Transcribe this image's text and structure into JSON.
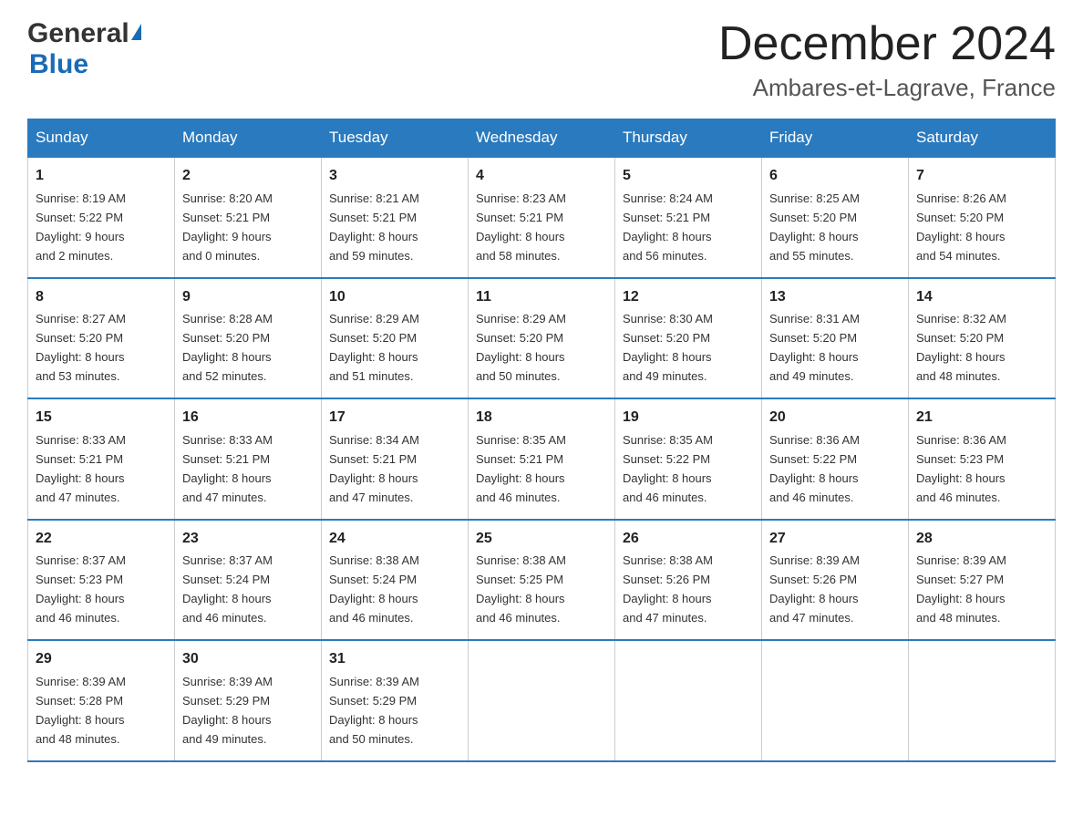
{
  "header": {
    "logo_general": "General",
    "logo_blue": "Blue",
    "month_title": "December 2024",
    "location": "Ambares-et-Lagrave, France"
  },
  "days_of_week": [
    "Sunday",
    "Monday",
    "Tuesday",
    "Wednesday",
    "Thursday",
    "Friday",
    "Saturday"
  ],
  "weeks": [
    [
      {
        "day": "1",
        "sunrise": "8:19 AM",
        "sunset": "5:22 PM",
        "daylight": "9 hours and 2 minutes."
      },
      {
        "day": "2",
        "sunrise": "8:20 AM",
        "sunset": "5:21 PM",
        "daylight": "9 hours and 0 minutes."
      },
      {
        "day": "3",
        "sunrise": "8:21 AM",
        "sunset": "5:21 PM",
        "daylight": "8 hours and 59 minutes."
      },
      {
        "day": "4",
        "sunrise": "8:23 AM",
        "sunset": "5:21 PM",
        "daylight": "8 hours and 58 minutes."
      },
      {
        "day": "5",
        "sunrise": "8:24 AM",
        "sunset": "5:21 PM",
        "daylight": "8 hours and 56 minutes."
      },
      {
        "day": "6",
        "sunrise": "8:25 AM",
        "sunset": "5:20 PM",
        "daylight": "8 hours and 55 minutes."
      },
      {
        "day": "7",
        "sunrise": "8:26 AM",
        "sunset": "5:20 PM",
        "daylight": "8 hours and 54 minutes."
      }
    ],
    [
      {
        "day": "8",
        "sunrise": "8:27 AM",
        "sunset": "5:20 PM",
        "daylight": "8 hours and 53 minutes."
      },
      {
        "day": "9",
        "sunrise": "8:28 AM",
        "sunset": "5:20 PM",
        "daylight": "8 hours and 52 minutes."
      },
      {
        "day": "10",
        "sunrise": "8:29 AM",
        "sunset": "5:20 PM",
        "daylight": "8 hours and 51 minutes."
      },
      {
        "day": "11",
        "sunrise": "8:29 AM",
        "sunset": "5:20 PM",
        "daylight": "8 hours and 50 minutes."
      },
      {
        "day": "12",
        "sunrise": "8:30 AM",
        "sunset": "5:20 PM",
        "daylight": "8 hours and 49 minutes."
      },
      {
        "day": "13",
        "sunrise": "8:31 AM",
        "sunset": "5:20 PM",
        "daylight": "8 hours and 49 minutes."
      },
      {
        "day": "14",
        "sunrise": "8:32 AM",
        "sunset": "5:20 PM",
        "daylight": "8 hours and 48 minutes."
      }
    ],
    [
      {
        "day": "15",
        "sunrise": "8:33 AM",
        "sunset": "5:21 PM",
        "daylight": "8 hours and 47 minutes."
      },
      {
        "day": "16",
        "sunrise": "8:33 AM",
        "sunset": "5:21 PM",
        "daylight": "8 hours and 47 minutes."
      },
      {
        "day": "17",
        "sunrise": "8:34 AM",
        "sunset": "5:21 PM",
        "daylight": "8 hours and 47 minutes."
      },
      {
        "day": "18",
        "sunrise": "8:35 AM",
        "sunset": "5:21 PM",
        "daylight": "8 hours and 46 minutes."
      },
      {
        "day": "19",
        "sunrise": "8:35 AM",
        "sunset": "5:22 PM",
        "daylight": "8 hours and 46 minutes."
      },
      {
        "day": "20",
        "sunrise": "8:36 AM",
        "sunset": "5:22 PM",
        "daylight": "8 hours and 46 minutes."
      },
      {
        "day": "21",
        "sunrise": "8:36 AM",
        "sunset": "5:23 PM",
        "daylight": "8 hours and 46 minutes."
      }
    ],
    [
      {
        "day": "22",
        "sunrise": "8:37 AM",
        "sunset": "5:23 PM",
        "daylight": "8 hours and 46 minutes."
      },
      {
        "day": "23",
        "sunrise": "8:37 AM",
        "sunset": "5:24 PM",
        "daylight": "8 hours and 46 minutes."
      },
      {
        "day": "24",
        "sunrise": "8:38 AM",
        "sunset": "5:24 PM",
        "daylight": "8 hours and 46 minutes."
      },
      {
        "day": "25",
        "sunrise": "8:38 AM",
        "sunset": "5:25 PM",
        "daylight": "8 hours and 46 minutes."
      },
      {
        "day": "26",
        "sunrise": "8:38 AM",
        "sunset": "5:26 PM",
        "daylight": "8 hours and 47 minutes."
      },
      {
        "day": "27",
        "sunrise": "8:39 AM",
        "sunset": "5:26 PM",
        "daylight": "8 hours and 47 minutes."
      },
      {
        "day": "28",
        "sunrise": "8:39 AM",
        "sunset": "5:27 PM",
        "daylight": "8 hours and 48 minutes."
      }
    ],
    [
      {
        "day": "29",
        "sunrise": "8:39 AM",
        "sunset": "5:28 PM",
        "daylight": "8 hours and 48 minutes."
      },
      {
        "day": "30",
        "sunrise": "8:39 AM",
        "sunset": "5:29 PM",
        "daylight": "8 hours and 49 minutes."
      },
      {
        "day": "31",
        "sunrise": "8:39 AM",
        "sunset": "5:29 PM",
        "daylight": "8 hours and 50 minutes."
      },
      null,
      null,
      null,
      null
    ]
  ],
  "labels": {
    "sunrise": "Sunrise:",
    "sunset": "Sunset:",
    "daylight": "Daylight:"
  }
}
